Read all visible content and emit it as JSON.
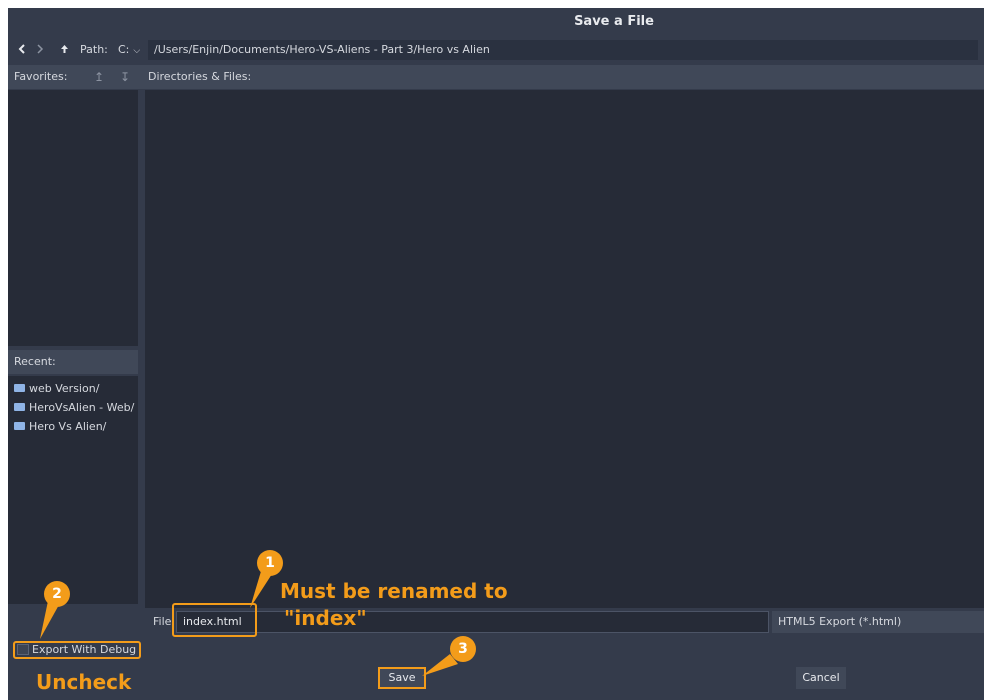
{
  "dialog": {
    "title": "Save a File"
  },
  "toolbar": {
    "back_icon": "chevron-left-icon",
    "forward_icon": "chevron-right-icon",
    "up_icon": "arrow-up-icon",
    "path_label": "Path:",
    "drive": "C:",
    "path_value": "/Users/Enjin/Documents/Hero-VS-Aliens - Part 3/Hero vs Alien"
  },
  "favorites": {
    "label": "Favorites:",
    "move_up_icon": "arrow-up-icon",
    "move_down_icon": "arrow-down-icon"
  },
  "files": {
    "label": "Directories & Files:"
  },
  "recent": {
    "label": "Recent:",
    "items": [
      {
        "label": "web Version/"
      },
      {
        "label": "HeroVsAlien - Web/"
      },
      {
        "label": "Hero Vs Alien/"
      }
    ]
  },
  "file_field": {
    "label": "File:",
    "value": "index.html"
  },
  "filter": {
    "selected": "HTML5 Export (*.html)"
  },
  "export_debug": {
    "label": "Export With Debug",
    "checked": false
  },
  "buttons": {
    "save": "Save",
    "cancel": "Cancel"
  },
  "annotations": {
    "badge_1": "1",
    "badge_2": "2",
    "badge_3": "3",
    "note_rename_line1": "Must be renamed to",
    "note_rename_line2": "\"index\"",
    "note_uncheck": "Uncheck",
    "accent_color": "#f39c1a"
  }
}
